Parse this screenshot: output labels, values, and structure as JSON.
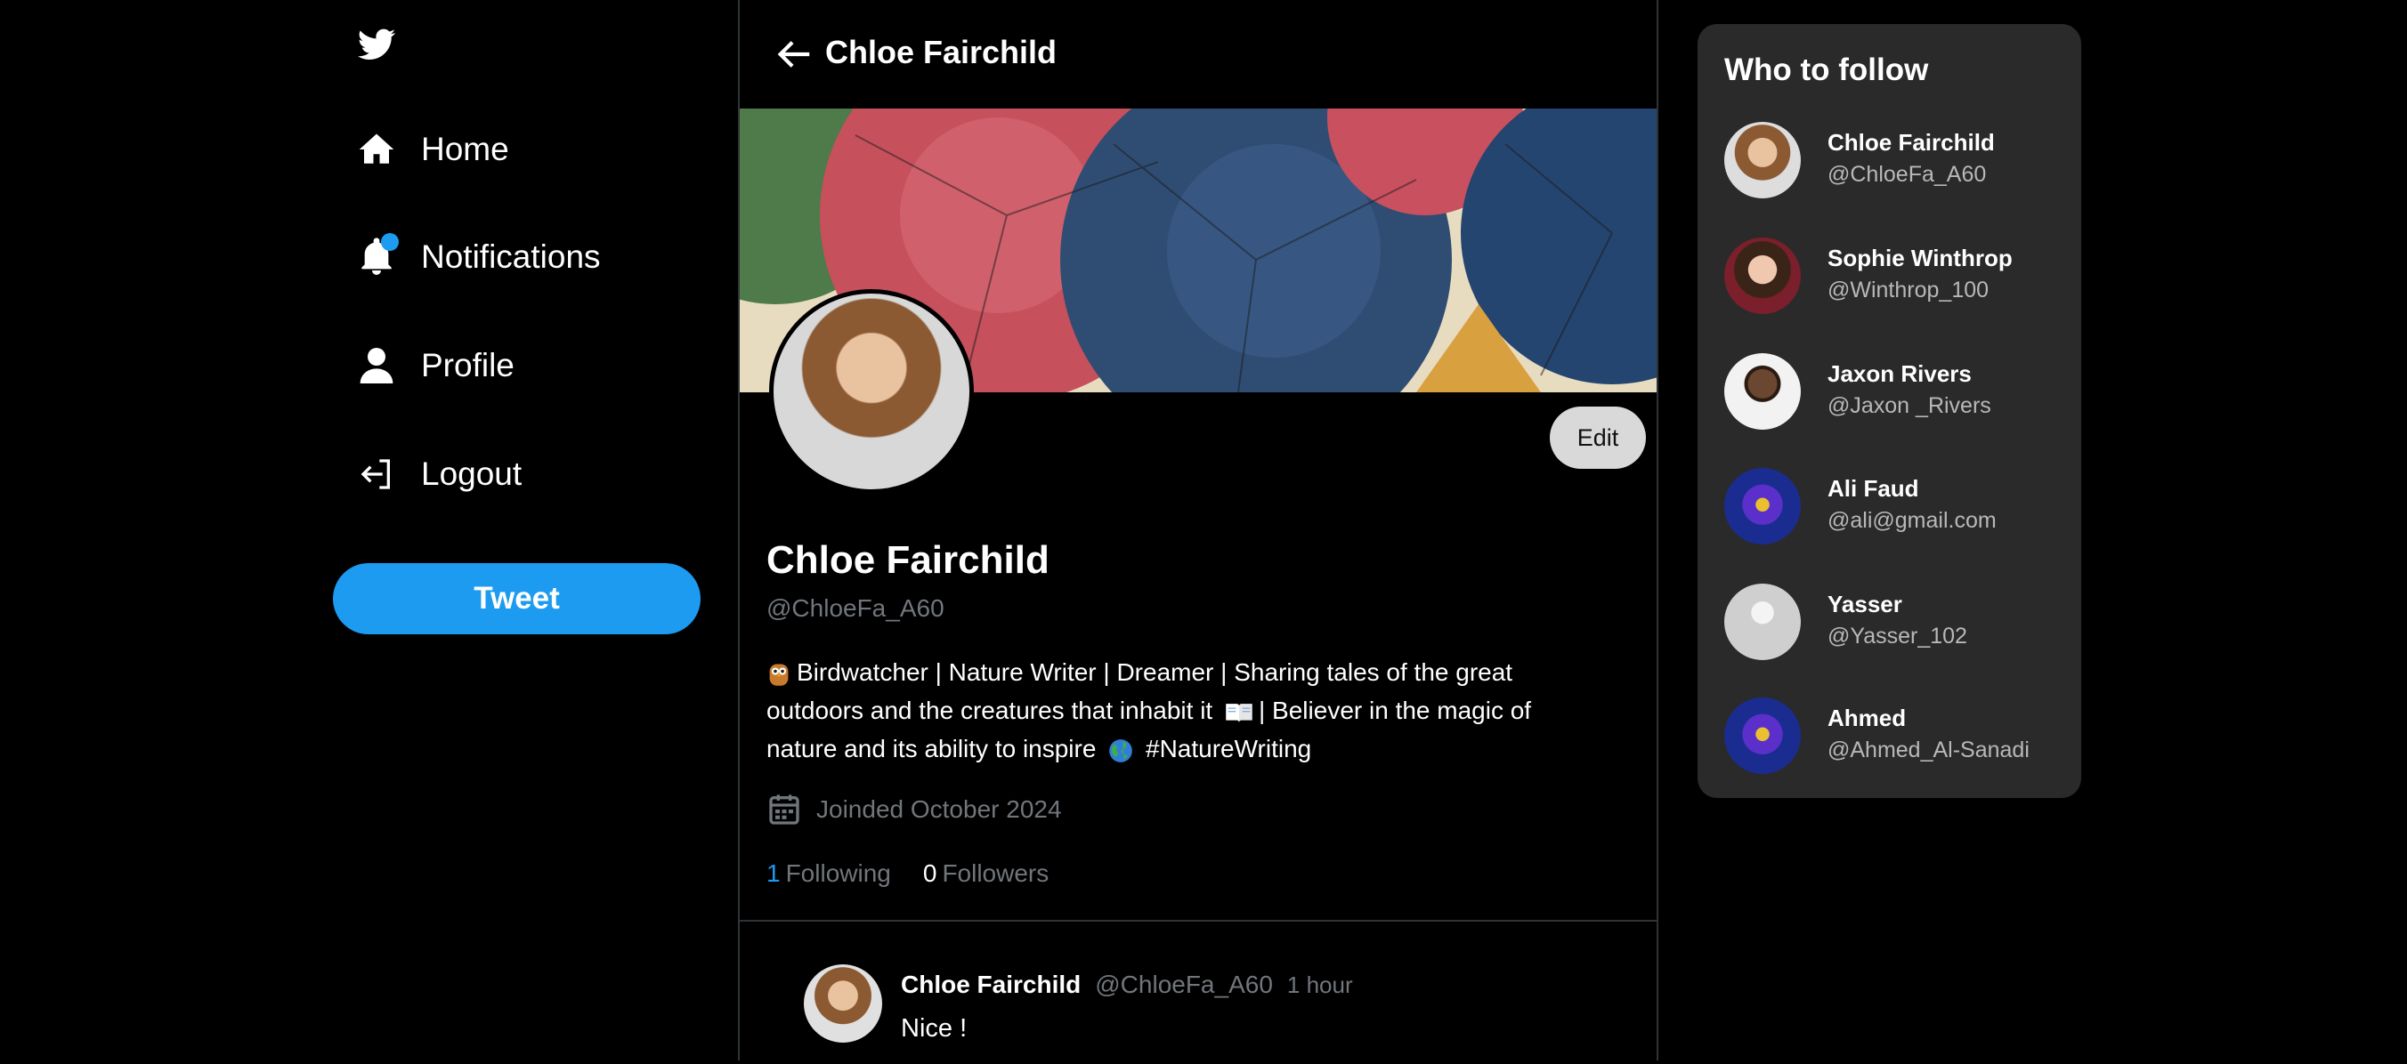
{
  "nav": {
    "items": [
      {
        "label": "Home",
        "icon": "home-icon"
      },
      {
        "label": "Notifications",
        "icon": "bell-icon"
      },
      {
        "label": "Profile",
        "icon": "user-icon"
      },
      {
        "label": "Logout",
        "icon": "logout-icon"
      }
    ],
    "tweet_label": "Tweet"
  },
  "header": {
    "title": "Chloe Fairchild"
  },
  "profile": {
    "name": "Chloe Fairchild",
    "handle": "@ChloeFa_A60",
    "edit_label": "Edit",
    "bio_part1": "Birdwatcher | Nature Writer | Dreamer | Sharing tales of the great outdoors and the creatures that inhabit it",
    "bio_part2": "| Believer in the magic of nature and its ability to inspire",
    "bio_part3": "#NatureWriting",
    "joined": "Joinded October 2024",
    "following_count": "1",
    "following_label": "Following",
    "followers_count": "0",
    "followers_label": "Followers"
  },
  "post": {
    "name": "Chloe Fairchild",
    "handle": "@ChloeFa_A60",
    "time": "1 hour",
    "text": "Nice !"
  },
  "who_to_follow": {
    "title": "Who to follow",
    "users": [
      {
        "name": "Chloe Fairchild",
        "handle": "@ChloeFa_A60"
      },
      {
        "name": "Sophie Winthrop",
        "handle": "@Winthrop_100"
      },
      {
        "name": "Jaxon Rivers",
        "handle": "@Jaxon _Rivers"
      },
      {
        "name": "Ali Faud",
        "handle": "@ali@gmail.com"
      },
      {
        "name": "Yasser",
        "handle": "@Yasser_102"
      },
      {
        "name": "Ahmed",
        "handle": "@Ahmed_Al-Sanadi"
      }
    ]
  },
  "colors": {
    "accent": "#1d9bf0",
    "panel": "#2a2a2a",
    "muted": "#71767b"
  }
}
